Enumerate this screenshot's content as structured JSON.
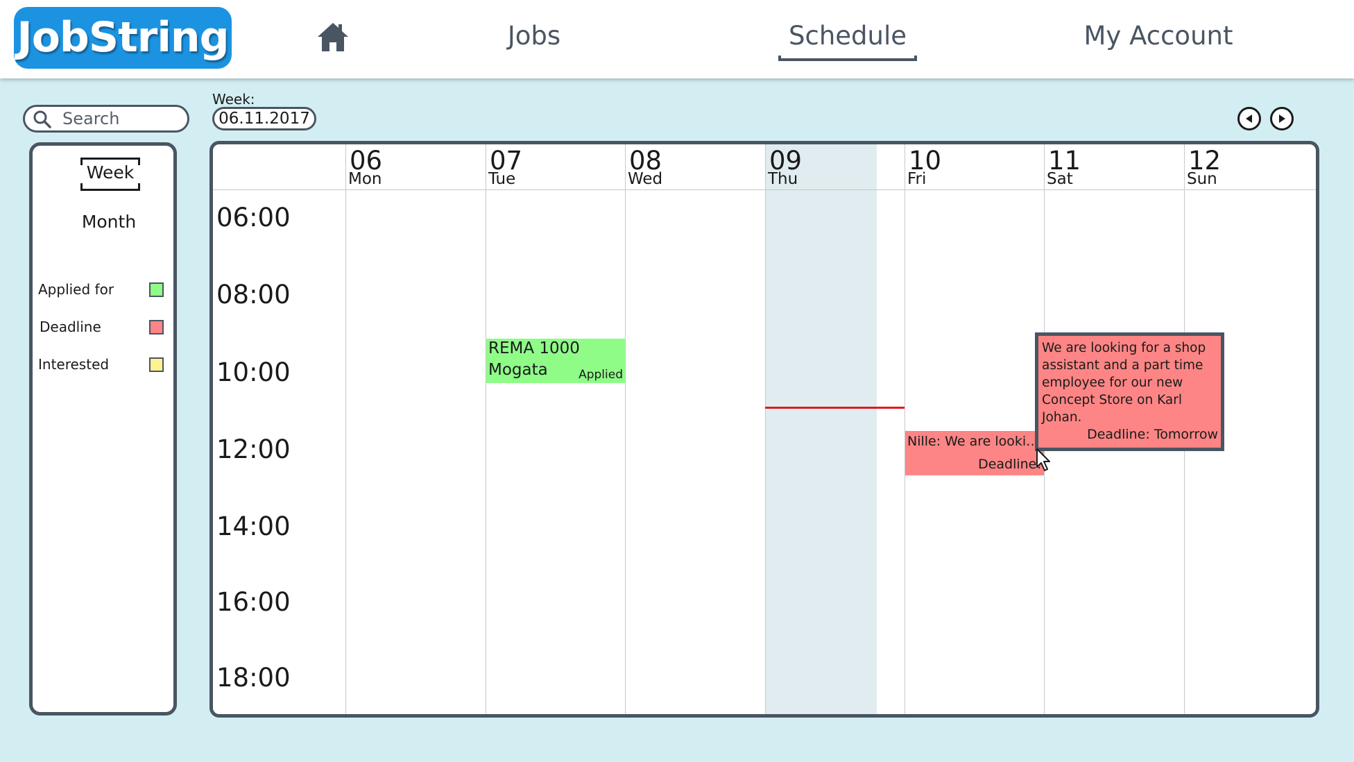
{
  "header": {
    "logo": "JobString",
    "nav": {
      "jobs": "Jobs",
      "schedule": "Schedule",
      "account": "My Account"
    }
  },
  "search": {
    "placeholder": "Search"
  },
  "week_selector": {
    "label": "Week:",
    "value": "06.11.2017"
  },
  "sidebar": {
    "views": {
      "week": "Week",
      "month": "Month",
      "selected": "Week"
    },
    "legend": [
      {
        "label": "Applied for",
        "color": "#8ffc88"
      },
      {
        "label": "Deadline",
        "color": "#fd8585"
      },
      {
        "label": "Interested",
        "color": "#fff28f"
      }
    ]
  },
  "calendar": {
    "days": [
      {
        "num": "06",
        "name": "Mon"
      },
      {
        "num": "07",
        "name": "Tue"
      },
      {
        "num": "08",
        "name": "Wed"
      },
      {
        "num": "09",
        "name": "Thu"
      },
      {
        "num": "10",
        "name": "Fri"
      },
      {
        "num": "11",
        "name": "Sat"
      },
      {
        "num": "12",
        "name": "Sun"
      }
    ],
    "today": "09",
    "times": [
      "06:00",
      "08:00",
      "10:00",
      "12:00",
      "14:00",
      "16:00",
      "18:00"
    ],
    "events": {
      "rema": {
        "line1": "REMA 1000",
        "line2": "Mogata",
        "status": "Applied"
      },
      "nille": {
        "title": "Nille: We are looking for a shop assistant",
        "deadline": "Deadline!"
      }
    },
    "popup": {
      "text": "We are looking for a shop assistant and a part time employee for our new Concept Store on Karl Johan.",
      "deadline": "Deadline: Tomorrow"
    }
  },
  "colors": {
    "brand": "#1c93e0",
    "background": "#d3eef3",
    "applied": "#8ffc88",
    "deadline": "#fd8585",
    "interested": "#fff28f",
    "current_time": "#e01b1b"
  },
  "icons": [
    "home-icon",
    "search-icon",
    "arrow-left-icon",
    "arrow-right-icon",
    "mouse-cursor-icon"
  ]
}
